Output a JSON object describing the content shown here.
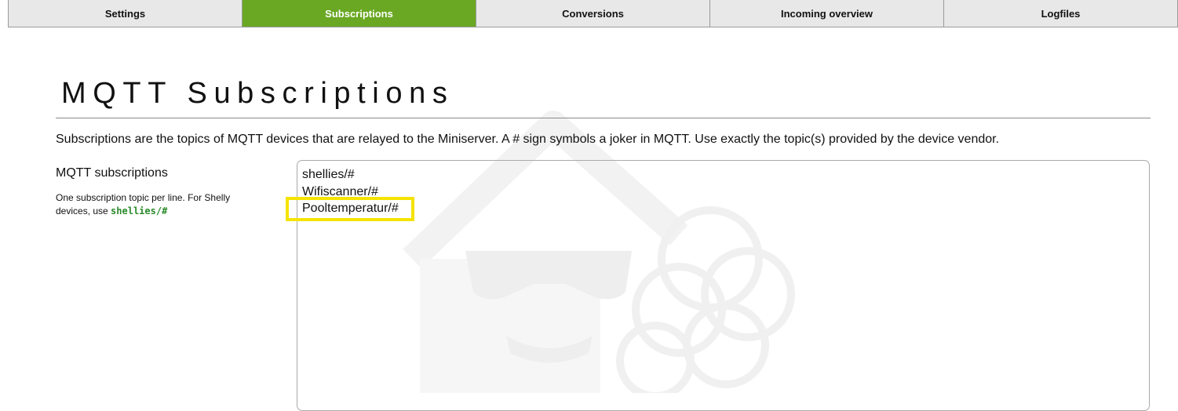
{
  "tabs": [
    {
      "label": "Settings",
      "active": false
    },
    {
      "label": "Subscriptions",
      "active": true
    },
    {
      "label": "Conversions",
      "active": false
    },
    {
      "label": "Incoming overview",
      "active": false
    },
    {
      "label": "Logfiles",
      "active": false
    }
  ],
  "page": {
    "title": "MQTT Subscriptions",
    "description": "Subscriptions are the topics of MQTT devices that are relayed to the Miniserver. A # sign symbols a joker in MQTT. Use exactly the topic(s) provided by the device vendor."
  },
  "subscriptions_field": {
    "label": "MQTT subscriptions",
    "help_text": "One subscription topic per line. For Shelly devices, use ",
    "help_code": "shellies/#",
    "lines": [
      "shellies/#",
      "Wifiscanner/#",
      "Pooltemperatur/#"
    ]
  },
  "colors": {
    "active_tab": "#6aa823",
    "tab_background": "#e8e8e8",
    "highlight": "#f5e300",
    "code_green": "#2a8a2a"
  },
  "icons": {
    "watermark": "loxberry-logo-icon"
  }
}
